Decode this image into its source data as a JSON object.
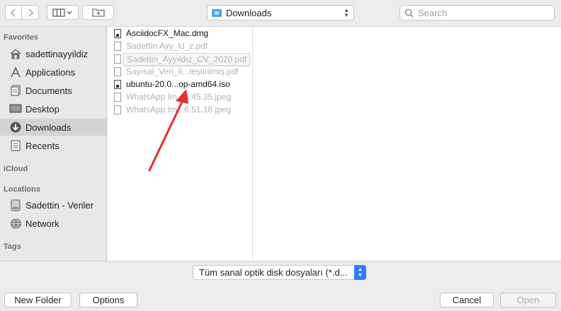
{
  "toolbar": {
    "location": "Downloads",
    "search_placeholder": "Search"
  },
  "sidebar": {
    "favorites_header": "Favorites",
    "favorites": [
      {
        "label": "sadettinayyildiz",
        "icon": "home-icon"
      },
      {
        "label": "Applications",
        "icon": "applications-icon"
      },
      {
        "label": "Documents",
        "icon": "documents-icon"
      },
      {
        "label": "Desktop",
        "icon": "desktop-icon"
      },
      {
        "label": "Downloads",
        "icon": "downloads-icon",
        "selected": true
      },
      {
        "label": "Recents",
        "icon": "recents-icon"
      }
    ],
    "icloud_header": "iCloud",
    "locations_header": "Locations",
    "locations": [
      {
        "label": "Sadettin - Veriler",
        "icon": "drive-icon"
      },
      {
        "label": "Network",
        "icon": "network-icon"
      }
    ],
    "tags_header": "Tags"
  },
  "files": [
    {
      "name": "AsciidocFX_Mac.dmg",
      "enabled": true
    },
    {
      "name": "Sadettin Ayy_ld_z.pdf",
      "enabled": false
    },
    {
      "name": "",
      "enabled": false
    },
    {
      "name": "Sayısal_Veri_İl...leştirilmiş.pdf",
      "enabled": false
    },
    {
      "name": "ubuntu-20.0...op-amd64.iso",
      "enabled": true
    },
    {
      "name": "WhatsApp Im...6.45.35.jpeg",
      "enabled": false
    },
    {
      "name": "WhatsApp Im...6.51.18.jpeg",
      "enabled": false
    }
  ],
  "tooltip": "Sadettin_Ayyıldız_CV_2020.pdf",
  "format": {
    "selected": "Tüm sanal optik disk dosyaları (*.d..."
  },
  "buttons": {
    "new_folder": "New Folder",
    "options": "Options",
    "cancel": "Cancel",
    "open": "Open"
  },
  "colors": {
    "accent": "#2f7cf6",
    "annotation_arrow": "#e03131"
  }
}
